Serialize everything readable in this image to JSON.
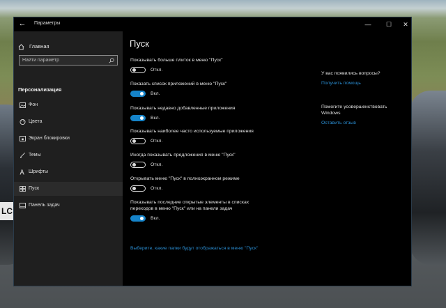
{
  "window": {
    "title": "Параметры",
    "back_glyph": "←",
    "minimize_glyph": "—",
    "maximize_glyph": "☐",
    "close_glyph": "✕"
  },
  "sidebar": {
    "home_label": "Главная",
    "search_placeholder": "Найти параметр",
    "section_title": "Персонализация",
    "items": [
      {
        "label": "Фон",
        "icon": "picture-icon"
      },
      {
        "label": "Цвета",
        "icon": "palette-icon"
      },
      {
        "label": "Экран блокировки",
        "icon": "lock-screen-icon"
      },
      {
        "label": "Темы",
        "icon": "brush-icon"
      },
      {
        "label": "Шрифты",
        "icon": "font-icon"
      },
      {
        "label": "Пуск",
        "icon": "start-icon",
        "selected": true
      },
      {
        "label": "Панель задач",
        "icon": "taskbar-icon"
      }
    ]
  },
  "main": {
    "title": "Пуск",
    "settings": [
      {
        "label": "Показывать больше плиток в меню \"Пуск\"",
        "state": "Откл.",
        "on": false
      },
      {
        "label": "Показать список приложений в меню \"Пуск\"",
        "state": "Вкл.",
        "on": true
      },
      {
        "label": "Показывать недавно добавленные приложения",
        "state": "Вкл.",
        "on": true
      },
      {
        "label": "Показывать наиболее часто используемые приложения",
        "state": "Откл.",
        "on": false
      },
      {
        "label": "Иногда показывать предложения в меню \"Пуск\"",
        "state": "Откл.",
        "on": false
      },
      {
        "label": "Открывать меню \"Пуск\" в полноэкранном режиме",
        "state": "Откл.",
        "on": false
      },
      {
        "label_line1": "Показывать последние открытые элементы в списках",
        "label_line2": "переходов в меню \"Пуск\" или на панели задач",
        "state": "Вкл.",
        "on": true
      }
    ],
    "folders_link": "Выберите, какие папки будут отображаться в меню \"Пуск\""
  },
  "aside": {
    "question": "У вас появились вопросы?",
    "help_link": "Получить помощь",
    "improve_line1": "Помогите усовершенствовать",
    "improve_line2": "Windows",
    "feedback_link": "Оставить отзыв"
  },
  "background": {
    "plate_text": "LC"
  },
  "colors": {
    "accent": "#1583c9",
    "link": "#2a8cd0",
    "sidebar_bg": "#1f1f1f",
    "content_bg": "#000000"
  }
}
